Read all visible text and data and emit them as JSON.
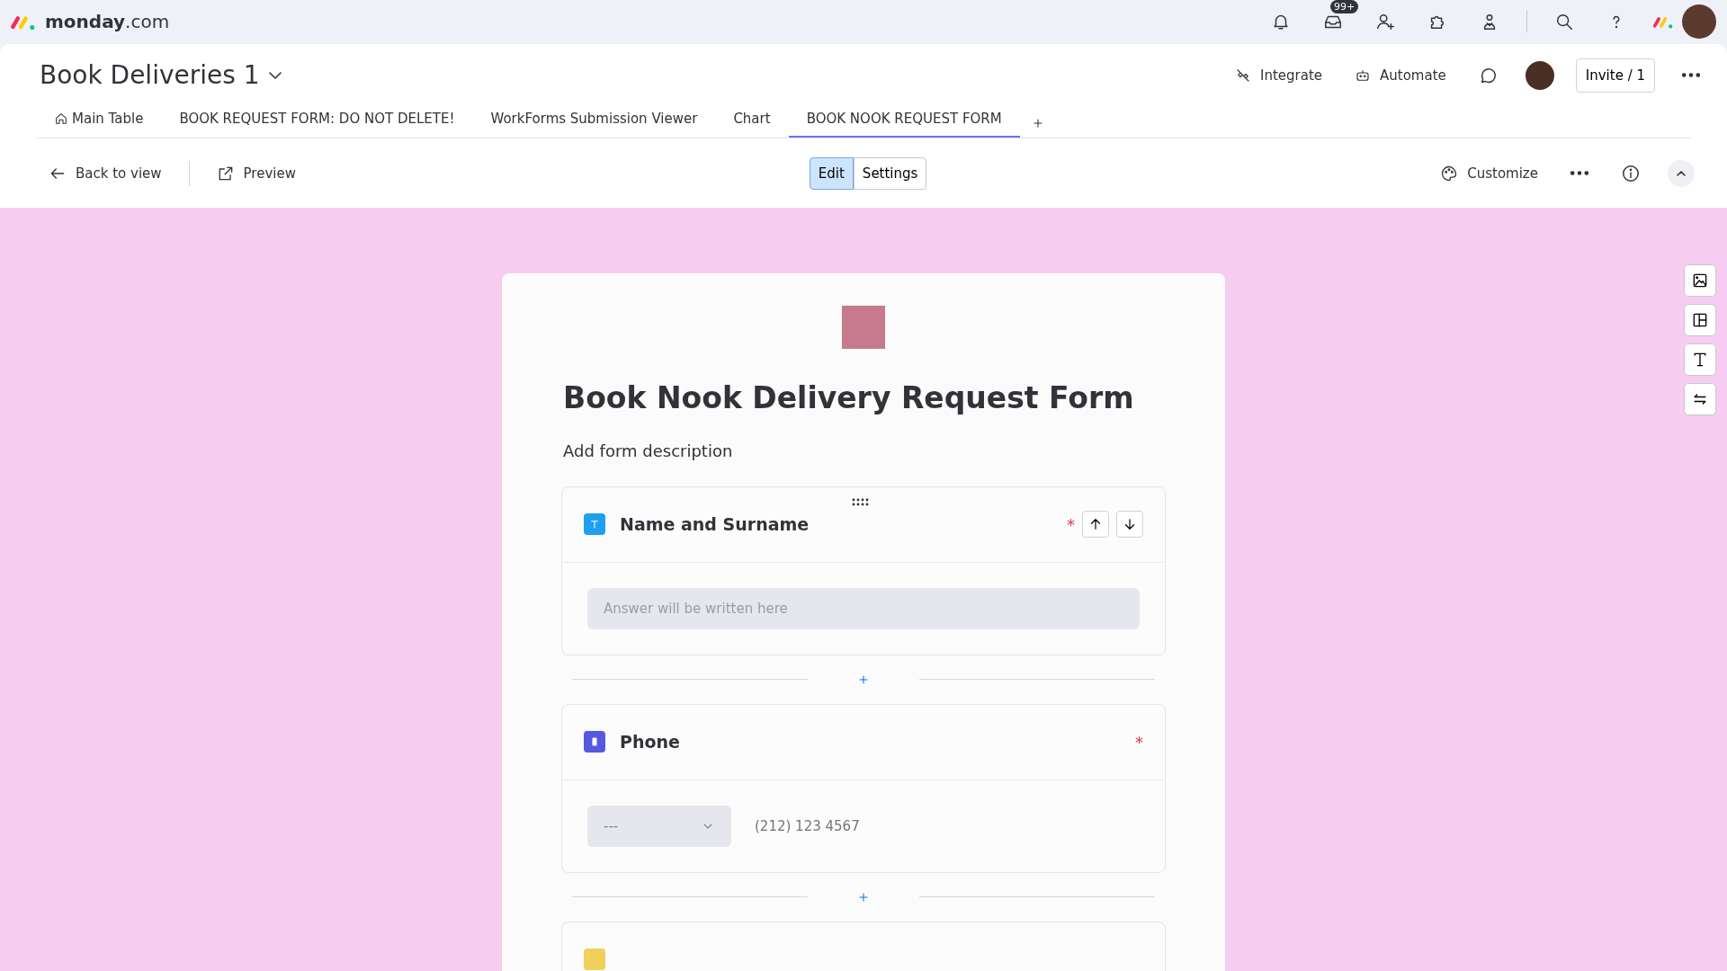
{
  "topbar": {
    "brand_bold": "monday",
    "brand_suffix": ".com",
    "notification_badge": "99+"
  },
  "board": {
    "title": "Book Deliveries 1",
    "actions": [
      "Integrate",
      "Automate"
    ],
    "invite": "Invite / 1"
  },
  "tabs": [
    {
      "label": "Main Table",
      "selected": false,
      "home": true
    },
    {
      "label": "BOOK REQUEST FORM: DO NOT DELETE!",
      "selected": false,
      "home": false
    },
    {
      "label": "WorkForms Submission Viewer",
      "selected": false,
      "home": false
    },
    {
      "label": "Chart",
      "selected": false,
      "home": false
    },
    {
      "label": "BOOK NOOK REQUEST FORM",
      "selected": true,
      "home": false
    }
  ],
  "toolbar": {
    "back": "Back to view",
    "preview": "Preview",
    "modes": [
      {
        "label": "Edit",
        "selected": true
      },
      {
        "label": "Settings",
        "selected": false
      }
    ],
    "customize": "Customize"
  },
  "form": {
    "title": "Book Nook Delivery Request Form",
    "description": "Add form description",
    "required_mark": "*",
    "fields": [
      {
        "kind": "text",
        "label": "Name and Surname",
        "color": "#1f9ff0",
        "required": true,
        "hovered": true,
        "placeholder": "Answer will be written here"
      },
      {
        "kind": "phone",
        "label": "Phone",
        "color": "#5559df",
        "required": true,
        "hovered": false,
        "country": "---",
        "placeholder": "(212) 123 4567"
      },
      {
        "kind": "cut",
        "color": "#f0cf5a",
        "required": false,
        "hovered": false
      }
    ]
  }
}
